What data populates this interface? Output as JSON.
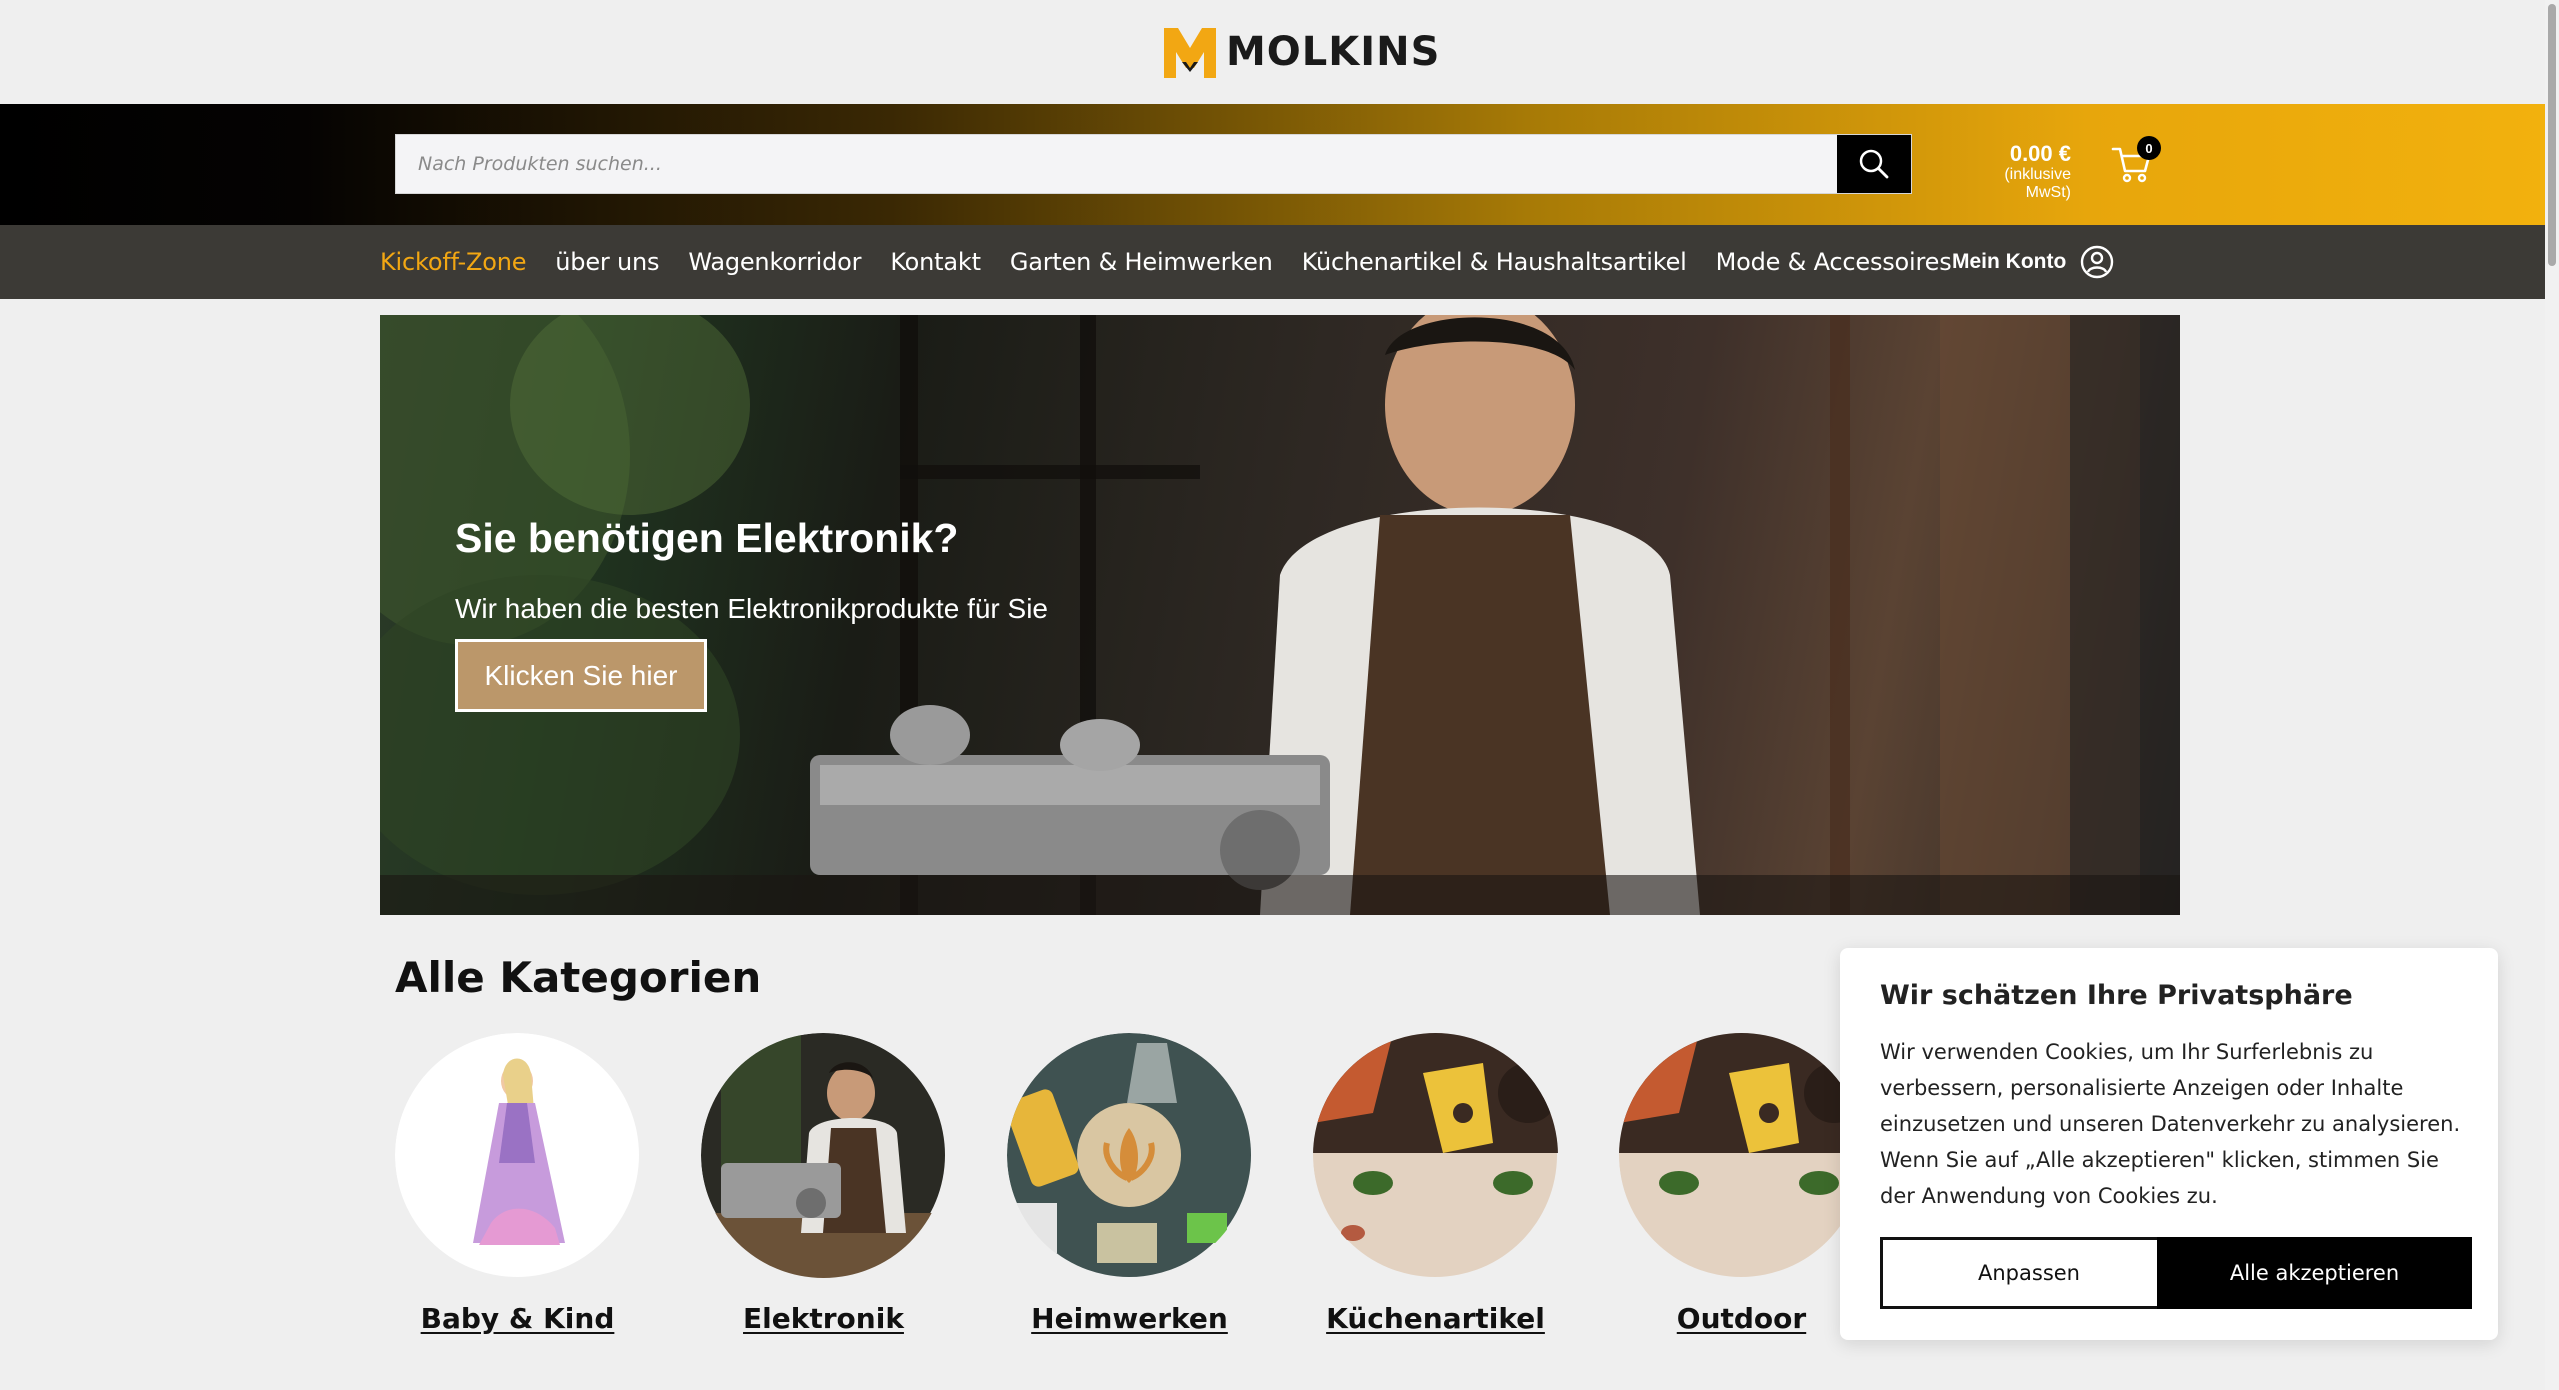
{
  "brand": {
    "name": "MOLKINS",
    "logo_icon": "m-logo-icon",
    "accent": "#f2a713"
  },
  "search": {
    "placeholder": "Nach Produkten suchen...",
    "value": "",
    "button_icon": "search-icon"
  },
  "cart": {
    "total": "0.00 €",
    "tax_note": "(inklusive MwSt)",
    "count": "0",
    "icon": "cart-icon"
  },
  "nav": {
    "items": [
      {
        "label": "Kickoff-Zone",
        "active": true
      },
      {
        "label": "über uns"
      },
      {
        "label": "Wagenkorridor"
      },
      {
        "label": "Kontakt"
      },
      {
        "label": "Garten & Heimwerken"
      },
      {
        "label": "Küchenartikel & Haushaltsartikel"
      },
      {
        "label": "Mode & Accessoires"
      }
    ],
    "account_label": "Mein Konto",
    "account_icon": "user-circle-icon"
  },
  "hero": {
    "title": "Sie benötigen Elektronik?",
    "subtitle": "Wir haben die besten Elektronikprodukte für Sie",
    "button_label": "Klicken Sie hier",
    "button_color": "#bb976a"
  },
  "categories": {
    "title": "Alle Kategorien",
    "items": [
      {
        "label": "Baby & Kind"
      },
      {
        "label": "Elektronik"
      },
      {
        "label": "Heimwerken"
      },
      {
        "label": "Küchenartikel"
      },
      {
        "label": "Outdoor"
      }
    ]
  },
  "cookie": {
    "title": "Wir schätzen Ihre Privatsphäre",
    "text": "Wir verwenden Cookies, um Ihr Surferlebnis zu verbessern, personalisierte Anzeigen oder Inhalte einzusetzen und unseren Datenverkehr zu analysieren. Wenn Sie auf „Alle akzeptieren\" klicken, stimmen Sie der Anwendung von Cookies zu.",
    "customize_label": "Anpassen",
    "accept_label": "Alle akzeptieren"
  }
}
